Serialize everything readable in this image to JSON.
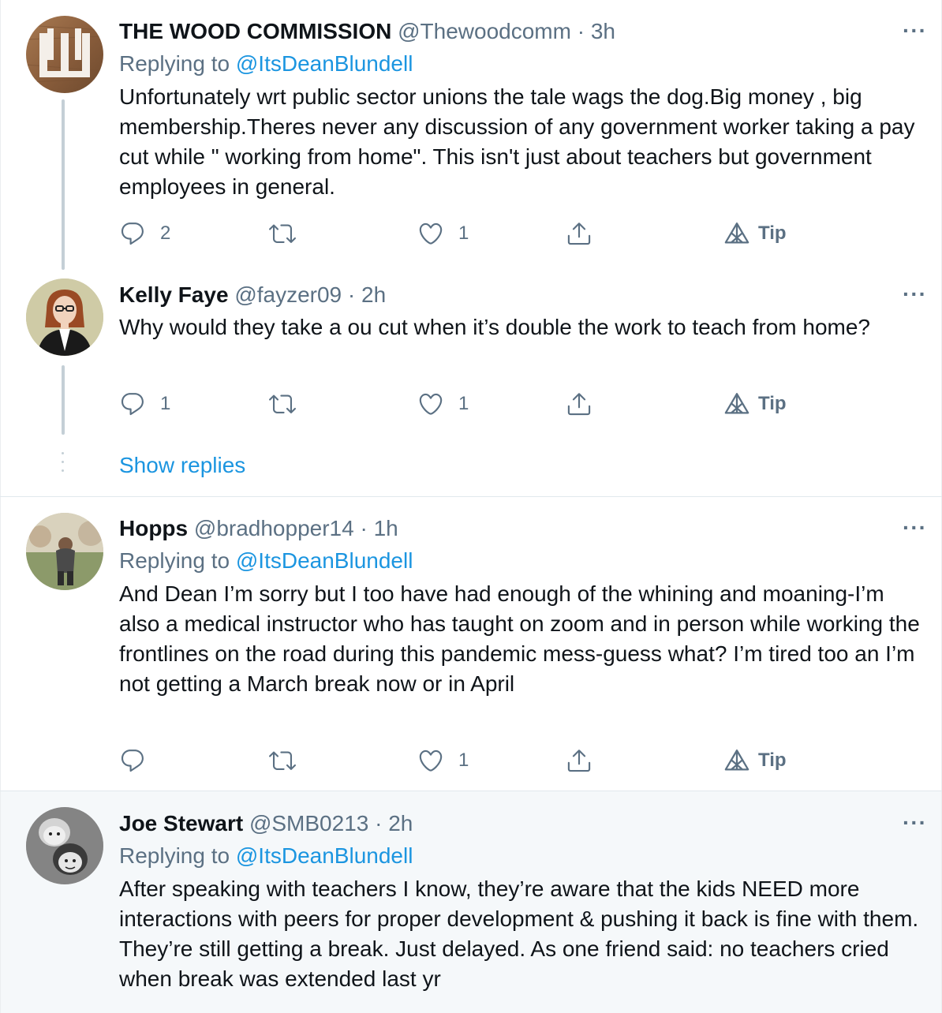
{
  "tweets": [
    {
      "name": "THE WOOD COMMISSION",
      "handle": "@Thewoodcomm",
      "time": "· 3h",
      "reply_label": "Replying to",
      "reply_handle": "@ItsDeanBlundell",
      "text": "Unfortunately wrt public sector unions the tale wags the dog.Big money , big membership.Theres never any discussion of any government worker taking a pay cut while \" working from home\". This isn't just about teachers but government employees in general.",
      "replies": "2",
      "likes": "1",
      "tip": "Tip"
    },
    {
      "name": "Kelly Faye",
      "handle": "@fayzer09",
      "time": "· 2h",
      "text": "Why would they take a ou cut when it’s double the work to teach from home?",
      "replies": "1",
      "likes": "1",
      "tip": "Tip"
    },
    {
      "name": "Hopps",
      "handle": "@bradhopper14",
      "time": "· 1h",
      "reply_label": "Replying to",
      "reply_handle": "@ItsDeanBlundell",
      "text": "And Dean I’m sorry but I too have had enough of the whining and moaning-I’m also a medical instructor who has taught on zoom and in person while working the frontlines on the road during this pandemic mess-guess what? I’m tired too an I’m not getting a March break now or in April",
      "likes": "1",
      "tip": "Tip"
    },
    {
      "name": "Joe Stewart",
      "handle": "@SMB0213",
      "time": "· 2h",
      "reply_label": "Replying to",
      "reply_handle": "@ItsDeanBlundell",
      "text": "After speaking with teachers I know, they’re aware that the kids NEED more interactions with peers for proper development & pushing it back is fine with them. They’re still getting a break. Just delayed. As one friend said: no teachers cried when break was extended last yr"
    }
  ],
  "show_replies": "Show replies",
  "more_icon": "···",
  "colors": {
    "link": "#1b95e0",
    "secondary": "#5b7083",
    "text": "#0f1419",
    "thread_line": "#c4cfd6"
  }
}
